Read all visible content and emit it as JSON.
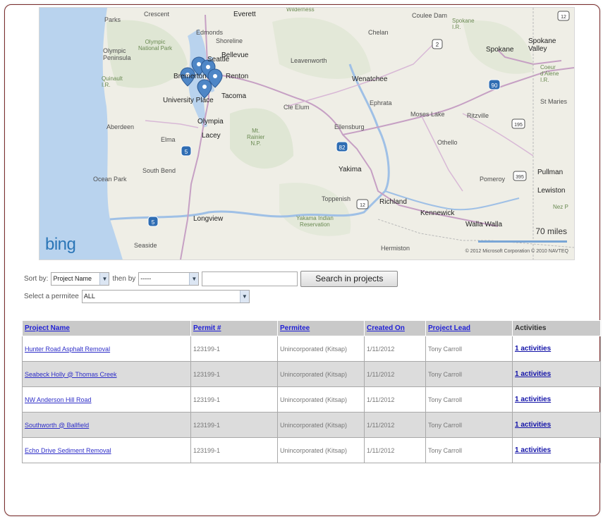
{
  "map": {
    "places": {
      "parks": "Parks",
      "crescent": "Crescent",
      "everett": "Everett",
      "wilderness": "Wilderness",
      "coulee_dam": "Coulee Dam",
      "spokane_ir": "Spokane\nI.R.",
      "edmonds": "Edmonds",
      "olympic_np": "Olympic\nNational Park",
      "olympic_pen": "Olympic\nPeninsula",
      "shoreline": "Shoreline",
      "bellevue": "Bellevue",
      "chelan": "Chelan",
      "spokane": "Spokane",
      "spokane_valley": "Spokane\nValley",
      "leavenworth": "Leavenworth",
      "quinault": "Quinault\nI.R.",
      "seattle": "Seattle",
      "bremerton": "Bremerton",
      "renton": "Renton",
      "wenatchee": "Wenatchee",
      "coeur": "Coeur\nd'Alene\nI.R.",
      "st_maries": "St Maries",
      "university_place": "University Place",
      "tacoma": "Tacoma",
      "cle_elum": "Cle Elum",
      "ephrata": "Ephrata",
      "moses_lake": "Moses Lake",
      "ritzville": "Ritzville",
      "olympia": "Olympia",
      "aberdeen": "Aberdeen",
      "elma": "Elma",
      "lacey": "Lacey",
      "mt_rainier": "Mt.\nRainier\nN.P.",
      "ellensburg": "Ellensburg",
      "othello": "Othello",
      "pullman": "Pullman",
      "south_bend": "South Bend",
      "ocean_park": "Ocean Park",
      "yakima": "Yakima",
      "pomeroy": "Pomeroy",
      "lewiston": "Lewiston",
      "toppenish": "Toppenish",
      "richland": "Richland",
      "kennewick": "Kennewick",
      "nez_perce": "Nez P",
      "longview": "Longview",
      "yakima_res": "Yakama Indian\nReservation",
      "walla_walla": "Walla Walla",
      "seaside": "Seaside",
      "hermiston": "Hermiston"
    },
    "shields": [
      "5",
      "5",
      "82",
      "90",
      "2",
      "195",
      "12",
      "12",
      "395"
    ],
    "logo": "bing",
    "scale_label": "70 miles",
    "copyright": "© 2012 Microsoft Corporation   © 2010 NAVTEQ"
  },
  "controls": {
    "sort_by_label": "Sort by:",
    "sort_by_value": "Project Name",
    "then_by_label": "then by",
    "then_by_value": "-----",
    "search_value": "",
    "search_button": "Search in projects",
    "permitee_label": "Select a permitee",
    "permitee_value": "ALL",
    "dropdown_arrow": "▼"
  },
  "table": {
    "headers": [
      "Project Name",
      "Permit #",
      "Permitee",
      "Created On",
      "Project Lead",
      "Activities"
    ],
    "rows": [
      {
        "name": "Hunter Road Asphalt Removal",
        "permit": "123199-1",
        "permitee": "Unincorporated (Kitsap)",
        "created": "1/11/2012",
        "lead": "Tony Carroll",
        "activities": "1 activities"
      },
      {
        "name": "Seabeck Holly @ Thomas Creek",
        "permit": "123199-1",
        "permitee": "Unincorporated (Kitsap)",
        "created": "1/11/2012",
        "lead": "Tony Carroll",
        "activities": "1 activities"
      },
      {
        "name": "NW Anderson Hill Road",
        "permit": "123199-1",
        "permitee": "Unincorporated (Kitsap)",
        "created": "1/11/2012",
        "lead": "Tony Carroll",
        "activities": "1 activities"
      },
      {
        "name": "Southworth @ Ballfield",
        "permit": "123199-1",
        "permitee": "Unincorporated (Kitsap)",
        "created": "1/11/2012",
        "lead": "Tony Carroll",
        "activities": "1 activities"
      },
      {
        "name": "Echo Drive Sediment Removal",
        "permit": "123199-1",
        "permitee": "Unincorporated (Kitsap)",
        "created": "1/11/2012",
        "lead": "Tony Carroll",
        "activities": "1 activities"
      }
    ]
  },
  "colors": {
    "map_water": "#b9d3ee",
    "map_land": "#efeee6",
    "pin": "#4e86c6",
    "link": "#2d2dc8",
    "header_bg": "#c9c9c9",
    "alt_row": "#dcdcdc"
  }
}
